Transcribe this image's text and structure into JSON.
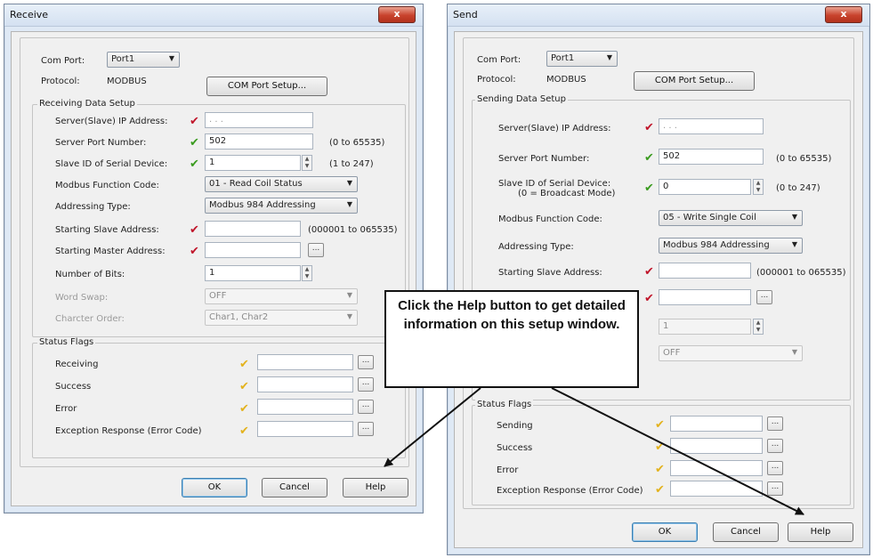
{
  "colors": {
    "check_red": "#c0152a",
    "check_green": "#3a9b1f",
    "check_yellow": "#e3b21d",
    "window_frame": "#dfe9f5"
  },
  "receive": {
    "title": "Receive",
    "close": "x",
    "com_port_label": "Com Port:",
    "com_port_value": "Port1",
    "protocol_label": "Protocol:",
    "protocol_value": "MODBUS",
    "com_setup_button": "COM Port Setup...",
    "data_group_title": "Receiving Data Setup",
    "server_ip_label": "Server(Slave) IP Address:",
    "server_ip_value": ".       .       .",
    "port_label": "Server Port Number:",
    "port_value": "502",
    "port_range": "(0 to 65535)",
    "slave_id_label": "Slave ID of Serial Device:",
    "slave_id_value": "1",
    "slave_id_range": "(1 to 247)",
    "function_label": "Modbus Function Code:",
    "function_value": "01 - Read Coil Status",
    "addressing_label": "Addressing Type:",
    "addressing_value": "Modbus 984 Addressing",
    "start_slave_label": "Starting Slave Address:",
    "start_slave_value": "",
    "start_slave_range": "(000001 to 065535)",
    "start_master_label": "Starting Master Address:",
    "start_master_value": "",
    "bits_label": "Number of Bits:",
    "bits_value": "1",
    "word_swap_label": "Word Swap:",
    "word_swap_value": "OFF",
    "char_order_label": "Charcter Order:",
    "char_order_value": "Char1, Char2",
    "status_group_title": "Status Flags",
    "flags": [
      "Receiving",
      "Success",
      "Error",
      "Exception Response (Error Code)"
    ],
    "ok": "OK",
    "cancel": "Cancel",
    "help": "Help"
  },
  "send": {
    "title": "Send",
    "close": "x",
    "com_port_label": "Com Port:",
    "com_port_value": "Port1",
    "protocol_label": "Protocol:",
    "protocol_value": "MODBUS",
    "com_setup_button": "COM Port Setup...",
    "data_group_title": "Sending Data Setup",
    "server_ip_label": "Server(Slave) IP Address:",
    "server_ip_value": ".       .       .",
    "port_label": "Server Port Number:",
    "port_value": "502",
    "port_range": "(0 to 65535)",
    "slave_id_label": "Slave ID of Serial Device:",
    "slave_id_label2": "(0 = Broadcast Mode)",
    "slave_id_value": "0",
    "slave_id_range": "(0 to 247)",
    "function_label": "Modbus Function Code:",
    "function_value": "05 - Write Single Coil",
    "addressing_label": "Addressing Type:",
    "addressing_value": "Modbus 984 Addressing",
    "start_slave_label": "Starting Slave Address:",
    "start_slave_value": "",
    "start_slave_range": "(000001 to 065535)",
    "start_master_value": "",
    "bits_value": "1",
    "word_swap_value": "OFF",
    "status_group_title": "Status Flags",
    "flags": [
      "Sending",
      "Success",
      "Error",
      "Exception Response (Error Code)"
    ],
    "ok": "OK",
    "cancel": "Cancel",
    "help": "Help"
  },
  "callout": {
    "text": "Click the Help button to get detailed information on this setup window."
  },
  "icons": {
    "valid": "checkmark-icon",
    "ellipsis": "..."
  }
}
